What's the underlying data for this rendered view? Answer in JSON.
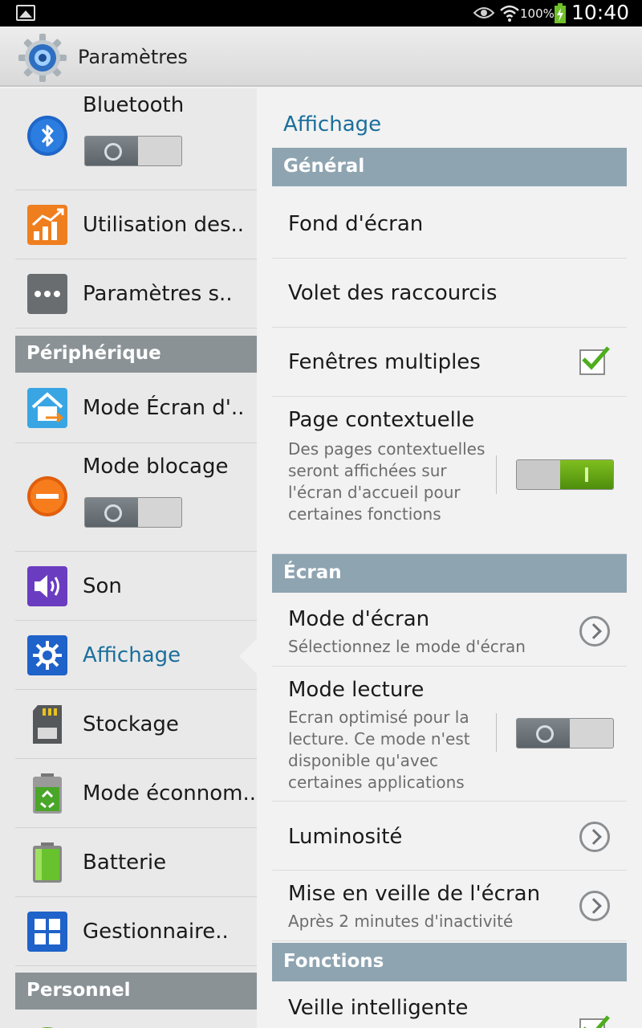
{
  "status_bar": {
    "battery_percent": "100%",
    "time": "10:40"
  },
  "app_bar": {
    "title": "Paramètres"
  },
  "sidebar": {
    "bluetooth": {
      "label": "Bluetooth",
      "enabled": false
    },
    "data_usage": {
      "label": "Utilisation des.."
    },
    "more_settings": {
      "label": "Paramètres s.."
    },
    "section_device": "Périphérique",
    "home_screen": {
      "label": "Mode Écran d'.."
    },
    "blocking": {
      "label": "Mode blocage",
      "enabled": false
    },
    "sound": {
      "label": "Son"
    },
    "display": {
      "label": "Affichage",
      "selected": true
    },
    "storage": {
      "label": "Stockage"
    },
    "power_saving": {
      "label": "Mode éconnom.."
    },
    "battery": {
      "label": "Batterie"
    },
    "app_manager": {
      "label": "Gestionnaire.."
    },
    "section_personal": "Personnel"
  },
  "detail": {
    "title": "Affichage",
    "section_general": "Général",
    "wallpaper": {
      "label": "Fond d'écran"
    },
    "notification_panel": {
      "label": "Volet des raccourcis"
    },
    "multi_window": {
      "label": "Fenêtres multiples",
      "checked": true
    },
    "page_buddy": {
      "label": "Page contextuelle",
      "description": "Des pages contextuelles seront affichées sur l'écran d'accueil pour certaines fonctions",
      "enabled": true
    },
    "section_screen": "Écran",
    "screen_mode": {
      "label": "Mode d'écran",
      "description": "Sélectionnez le mode d'écran"
    },
    "reading_mode": {
      "label": "Mode lecture",
      "description": "Ecran optimisé pour la lecture. Ce mode n'est disponible qu'avec certaines applications",
      "enabled": false
    },
    "brightness": {
      "label": "Luminosité"
    },
    "screen_timeout": {
      "label": "Mise en veille de l'écran",
      "description": "Après 2 minutes d'inactivité"
    },
    "section_features": "Fonctions",
    "smart_stay": {
      "label": "Veille intelligente",
      "checked": true
    }
  },
  "colors": {
    "accent": "#1b6f9c",
    "toggle_on": "#5fa514",
    "check": "#4cae1c",
    "left_header": "#8a9296",
    "right_header": "#8ea4b1"
  }
}
